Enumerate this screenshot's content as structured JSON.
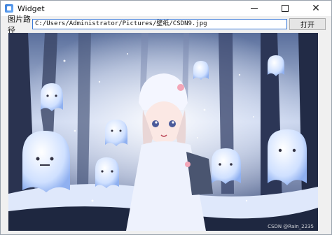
{
  "window": {
    "title": "Widget",
    "icon": "qt-app-icon",
    "controls": {
      "minimize_icon": "minimize-icon",
      "maximize_icon": "maximize-icon",
      "close_symbol": "✕"
    }
  },
  "toolbar": {
    "path_label": "图片路径",
    "path_value": "C:/Users/Administrator/Pictures/壁纸/CSDN9.jpg",
    "open_label": "打开"
  },
  "image": {
    "description_icon": "anime-winter-forest-image",
    "watermark": "CSDN @Rain_2235"
  },
  "colors": {
    "accent": "#3b7ad8",
    "window_bg": "#f0f0f0"
  }
}
